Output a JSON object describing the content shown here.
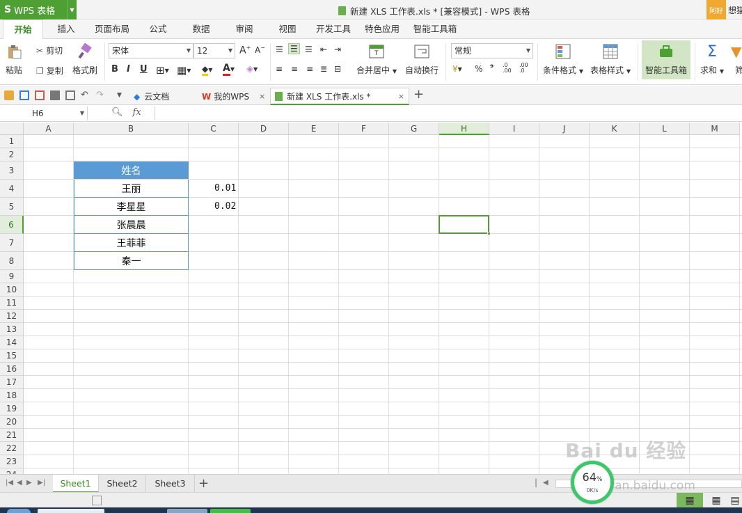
{
  "titlebar": {
    "app_name": "WPS 表格",
    "app_logo": "S",
    "doc_title": "新建 XLS 工作表.xls * [兼容模式] - WPS 表格",
    "right_badge": "阿好",
    "right_text": "想猫"
  },
  "menu": {
    "tabs": [
      "开始",
      "插入",
      "页面布局",
      "公式",
      "数据",
      "审阅",
      "视图",
      "开发工具",
      "特色应用",
      "智能工具箱"
    ],
    "active": "开始"
  },
  "ribbon": {
    "paste": "粘贴",
    "cut": "剪切",
    "copy": "复制",
    "format_painter": "格式刷",
    "font_name": "宋体",
    "font_size": "12",
    "bold": "B",
    "italic": "I",
    "underline": "U",
    "merge_center": "合并居中",
    "wrap_text": "自动换行",
    "number_format": "常规",
    "percent": "%",
    "comma": "⁹",
    "inc_decimal": ".0 .00",
    "dec_decimal": ".00 .0",
    "conditional_format": "条件格式",
    "table_style": "表格样式",
    "smart_toolbox": "智能工具箱",
    "sum": "求和",
    "filter": "筛"
  },
  "doc_tabs": [
    {
      "label": "云文档"
    },
    {
      "label": "我的WPS"
    },
    {
      "label": "新建 XLS 工作表.xls *"
    }
  ],
  "formula_bar": {
    "cell_ref": "H6",
    "fx": "fx",
    "content": ""
  },
  "columns": [
    "A",
    "B",
    "C",
    "D",
    "E",
    "F",
    "G",
    "H",
    "I",
    "J",
    "K",
    "L",
    "M"
  ],
  "rows": [
    "1",
    "2",
    "3",
    "4",
    "5",
    "6",
    "7",
    "8",
    "9",
    "10",
    "11",
    "12",
    "13",
    "14",
    "15",
    "16",
    "17",
    "18",
    "19",
    "20",
    "21",
    "22",
    "23",
    "24"
  ],
  "selected_cell": {
    "column": "H",
    "row": "6"
  },
  "cells": {
    "B3": "姓名",
    "B4": "王丽",
    "B5": "李星星",
    "B6": "张晨晨",
    "B7": "王菲菲",
    "B8": "秦一",
    "C4": "0.01",
    "C5": "0.02"
  },
  "sheets": [
    "Sheet1",
    "Sheet2",
    "Sheet3"
  ],
  "active_sheet": "Sheet1",
  "speed_widget": {
    "percent": "64",
    "unit": "%",
    "rate": "0K/s"
  },
  "watermark": {
    "text": "Bai du 经验",
    "url": "jingyan.baidu.com"
  },
  "colors": {
    "brand": "#4e9f34",
    "header_fill": "#5b9bd5"
  }
}
